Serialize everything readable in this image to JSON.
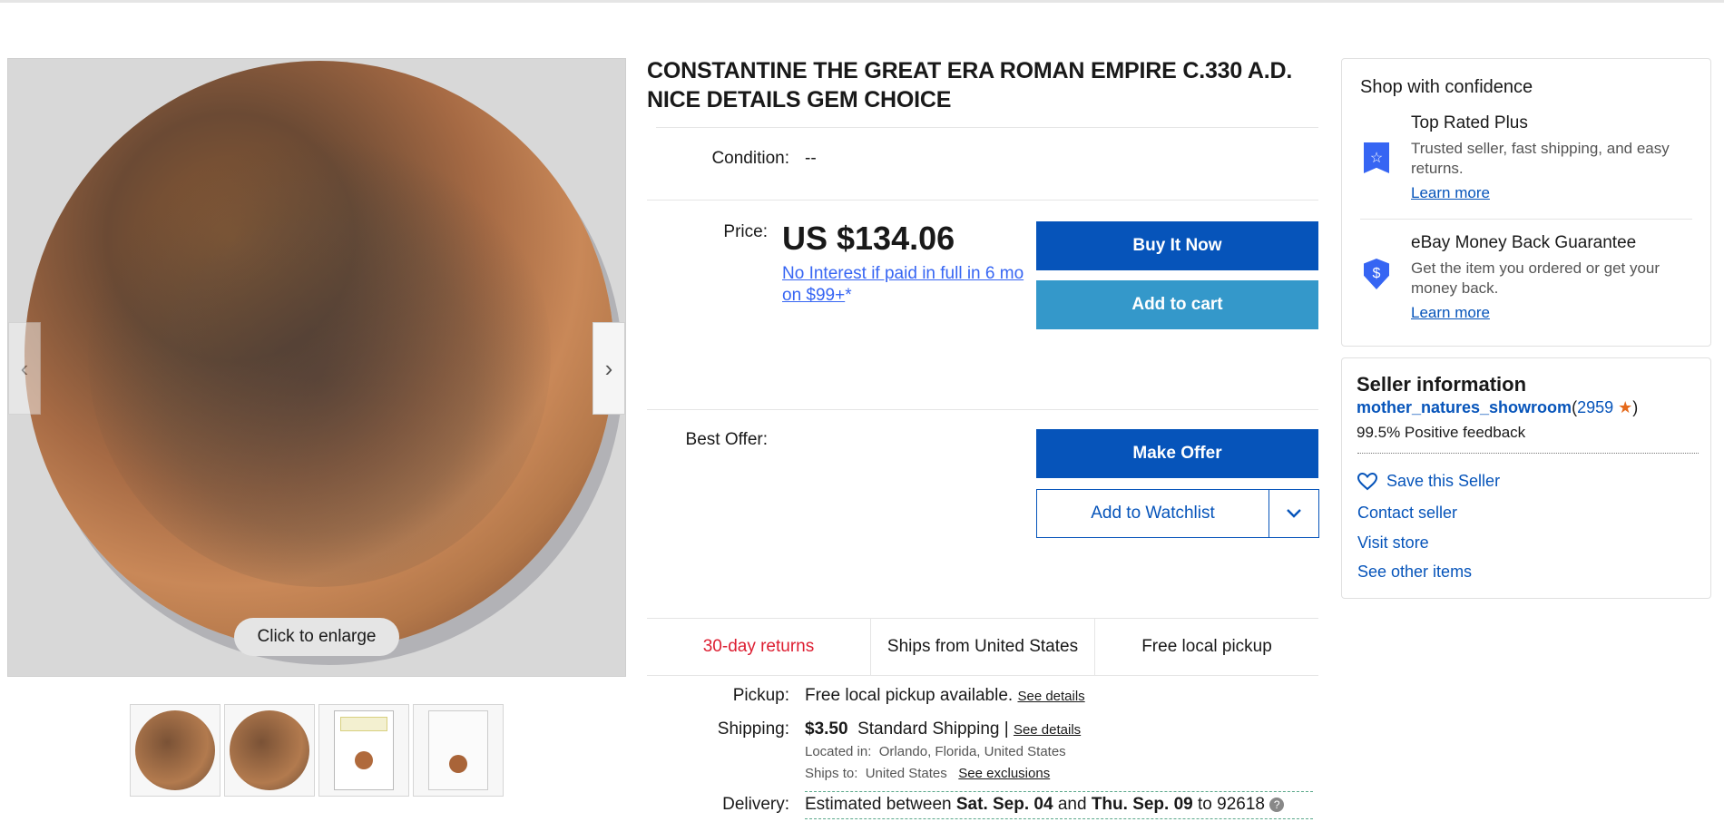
{
  "gallery": {
    "enlarge_label": "Click to enlarge",
    "prev_arrow": "‹",
    "next_arrow": "›",
    "thumb_count": 4
  },
  "item": {
    "title": "CONSTANTINE THE GREAT ERA ROMAN EMPIRE C.330 A.D. NICE DETAILS GEM CHOICE",
    "condition_label": "Condition:",
    "condition_value": "--",
    "price_label": "Price:",
    "price": "US $134.06",
    "credit_text": "No Interest if paid in full in 6 mo on $99+",
    "credit_star": "*",
    "best_offer_label": "Best Offer:"
  },
  "actions": {
    "buy_now": "Buy It Now",
    "add_to_cart": "Add to cart",
    "make_offer": "Make Offer",
    "add_to_watchlist": "Add to Watchlist",
    "watchlist_dropdown": "⌄"
  },
  "features": {
    "returns": "30-day returns",
    "ships_from": "Ships from United States",
    "pickup": "Free local pickup"
  },
  "shipping": {
    "pickup_label": "Pickup:",
    "pickup_value": "Free local pickup available.",
    "pickup_details": "See details",
    "shipping_label": "Shipping:",
    "shipping_cost": "$3.50",
    "shipping_method": "Standard Shipping",
    "shipping_sep": "|",
    "shipping_details": "See details",
    "located_label": "Located in:",
    "located_value": "Orlando, Florida, United States",
    "ships_to_label": "Ships to:",
    "ships_to_value": "United States",
    "exclusions": "See exclusions",
    "delivery_label": "Delivery:",
    "delivery_prefix": "Estimated between",
    "delivery_start": "Sat. Sep. 04",
    "delivery_and": "and",
    "delivery_end": "Thu. Sep. 09",
    "delivery_to": "to 92618",
    "help_icon": "?"
  },
  "confidence": {
    "heading": "Shop with confidence",
    "top_rated_title": "Top Rated Plus",
    "top_rated_desc": "Trusted seller, fast shipping, and easy returns.",
    "top_rated_link": "Learn more",
    "guarantee_title": "eBay Money Back Guarantee",
    "guarantee_desc": "Get the item you ordered or get your money back.",
    "guarantee_link": "Learn more"
  },
  "seller": {
    "heading": "Seller information",
    "name": "mother_natures_showroom",
    "open_paren": "(",
    "score": "2959",
    "close_paren": ")",
    "feedback": "99.5% Positive feedback",
    "save": "Save this Seller",
    "contact": "Contact seller",
    "store": "Visit store",
    "other": "See other items"
  },
  "colors": {
    "primary": "#0654ba",
    "secondary": "#3498ca",
    "link": "#3665f3",
    "red": "#dd1e31"
  }
}
